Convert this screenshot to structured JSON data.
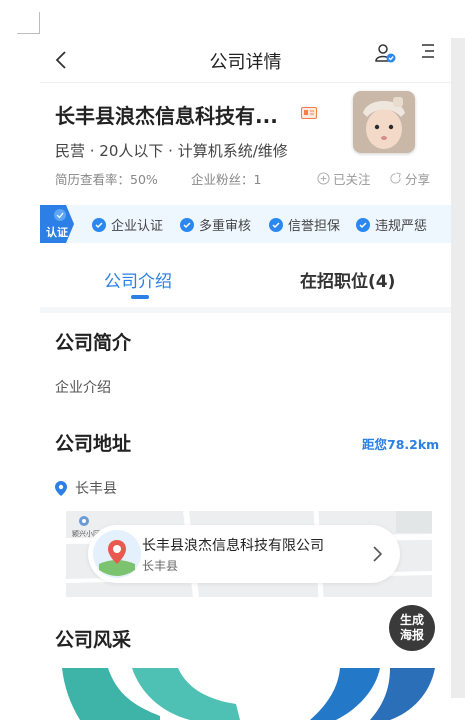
{
  "nav": {
    "title": "公司详情",
    "back_icon": "chevron-left-icon",
    "user_icon": "user-verified-icon",
    "menu_icon": "menu-icon"
  },
  "company": {
    "name": "长丰县浪杰信息科技有...",
    "meta": "民营 · 20人以下 · 计算机系统/维修",
    "resume_view_rate": "简历查看率：50%",
    "fans": "企业粉丝：1",
    "follow_label": "已关注",
    "share_label": "分享"
  },
  "cert": {
    "badge_label": "认证",
    "items": [
      "企业认证",
      "多重审核",
      "信誉担保",
      "违规严惩"
    ]
  },
  "tabs": {
    "intro": "公司介绍",
    "jobs": "在招职位(4)"
  },
  "sections": {
    "brief_title": "公司简介",
    "brief_text": "企业介绍",
    "address_title": "公司地址",
    "distance": "距您78.2km",
    "address": "长丰县",
    "map_label": "颍兴小区",
    "map_card_name": "长丰县浪杰信息科技有限公司",
    "map_card_sub": "长丰县",
    "style_title": "公司风采"
  },
  "poster_button": {
    "line1": "生成",
    "line2": "海报"
  },
  "colors": {
    "accent": "#2b7fe5",
    "cert_bg": "#eef6fe",
    "poster_bg": "#3a3a3a"
  }
}
